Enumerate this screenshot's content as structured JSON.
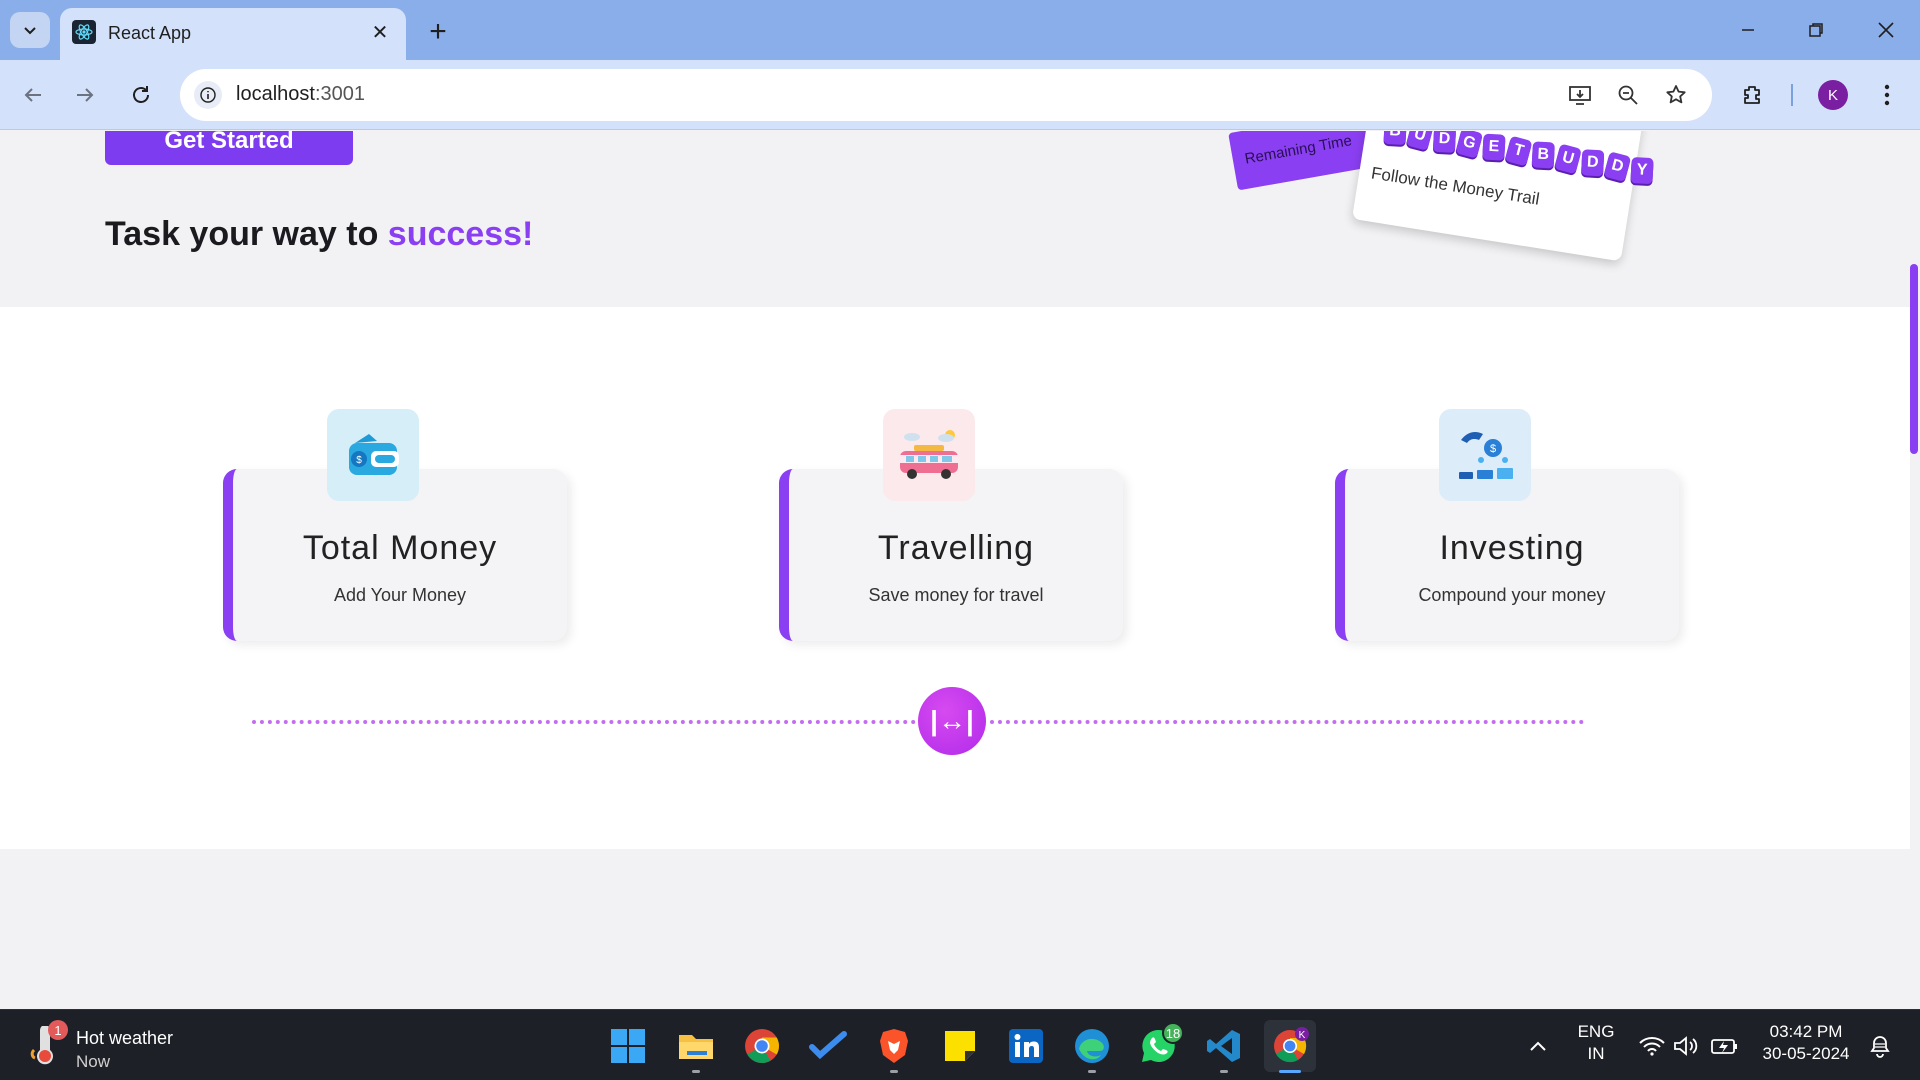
{
  "browser": {
    "tab_title": "React App",
    "url_host": "localhost",
    "url_port": ":3001",
    "profile_initial": "K"
  },
  "hero": {
    "get_started_label": "Get Started",
    "tagline_prefix": "Task your way to ",
    "tagline_accent": "success!",
    "sticker_purple_text": "Remaining Time",
    "brand_letters": [
      "B",
      "U",
      "D",
      "G",
      "E",
      "T",
      "B",
      "U",
      "D",
      "D",
      "Y"
    ],
    "sticker_trail_text": "Follow the Money Trail"
  },
  "features": [
    {
      "title": "Total Money",
      "subtitle": "Add Your Money",
      "icon": "wallet-icon",
      "icon_bg": "#d5eef7"
    },
    {
      "title": "Travelling",
      "subtitle": "Save money for travel",
      "icon": "van-icon",
      "icon_bg": "#fbe9ec"
    },
    {
      "title": "Investing",
      "subtitle": "Compound your money",
      "icon": "invest-icon",
      "icon_bg": "#dcecf9"
    }
  ],
  "timeline": {
    "button_glyph": "|↔|"
  },
  "colors": {
    "accent": "#8b3ff2",
    "tab_bar": "#8aaee9",
    "toolbar": "#d3e2fa",
    "taskbar": "#1d2027"
  },
  "taskbar": {
    "weather_title": "Hot weather",
    "weather_sub": "Now",
    "weather_badge": "1",
    "whatsapp_badge": "18",
    "lang_top": "ENG",
    "lang_bottom": "IN",
    "time": "03:42 PM",
    "date": "30-05-2024",
    "apps": [
      "start-icon",
      "file-explorer-icon",
      "chrome-icon",
      "todo-icon",
      "brave-icon",
      "sticky-notes-icon",
      "linkedin-icon",
      "edge-icon",
      "whatsapp-icon",
      "vscode-icon",
      "chrome-profile-icon"
    ]
  }
}
